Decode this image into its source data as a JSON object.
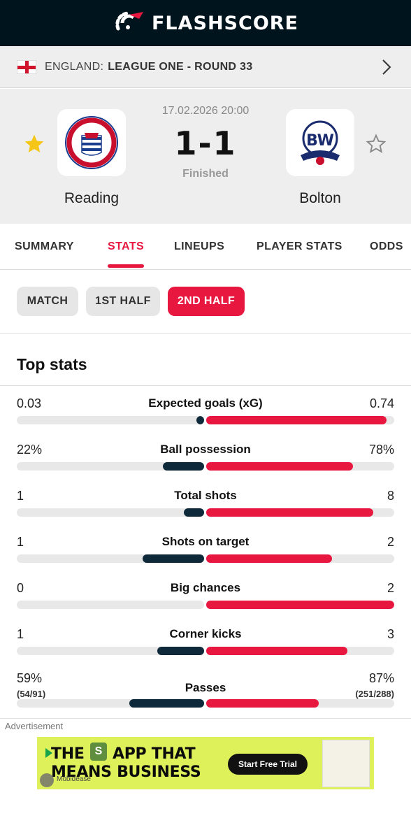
{
  "app": {
    "brand": "FLASHSCORE"
  },
  "league": {
    "country": "ENGLAND:",
    "name": "LEAGUE ONE - ROUND 33"
  },
  "match": {
    "datetime": "17.02.2026 20:00",
    "score": "1-1",
    "status": "Finished",
    "home": {
      "name": "Reading",
      "favorite": true,
      "crest_icon": "reading-fc-crest"
    },
    "away": {
      "name": "Bolton",
      "favorite": false,
      "crest_icon": "bolton-wanderers-crest"
    }
  },
  "tabs": [
    {
      "label": "SUMMARY",
      "active": false
    },
    {
      "label": "STATS",
      "active": true
    },
    {
      "label": "LINEUPS",
      "active": false
    },
    {
      "label": "PLAYER STATS",
      "active": false
    },
    {
      "label": "ODDS",
      "active": false
    }
  ],
  "periods": [
    {
      "label": "MATCH",
      "active": false
    },
    {
      "label": "1ST HALF",
      "active": false
    },
    {
      "label": "2ND HALF",
      "active": true
    }
  ],
  "top_stats": {
    "title": "Top stats",
    "rows": [
      {
        "label": "Expected goals (xG)",
        "home": "0.03",
        "away": "0.74",
        "home_share": 0.04,
        "away_share": 0.96
      },
      {
        "label": "Ball possession",
        "home": "22%",
        "away": "78%",
        "home_share": 0.22,
        "away_share": 0.78
      },
      {
        "label": "Total shots",
        "home": "1",
        "away": "8",
        "home_share": 0.11,
        "away_share": 0.89
      },
      {
        "label": "Shots on target",
        "home": "1",
        "away": "2",
        "home_share": 0.33,
        "away_share": 0.67
      },
      {
        "label": "Big chances",
        "home": "0",
        "away": "2",
        "home_share": 0.0,
        "away_share": 1.0
      },
      {
        "label": "Corner kicks",
        "home": "1",
        "away": "3",
        "home_share": 0.25,
        "away_share": 0.75
      },
      {
        "label": "Passes",
        "home": "59%",
        "away": "87%",
        "home_sub": "(54/91)",
        "away_sub": "(251/288)",
        "home_share": 0.4,
        "away_share": 0.6
      }
    ]
  },
  "ad": {
    "label": "Advertisement",
    "line1": "THE",
    "line1b": "APP THAT",
    "line2": "MEANS BUSINESS",
    "cta": "Start Free Trial",
    "brand": "Mobidease"
  },
  "colors": {
    "accent": "#e8173f",
    "home_bar": "#0e2a3a",
    "header_bg": "#00141e",
    "star": "#f5c518"
  }
}
